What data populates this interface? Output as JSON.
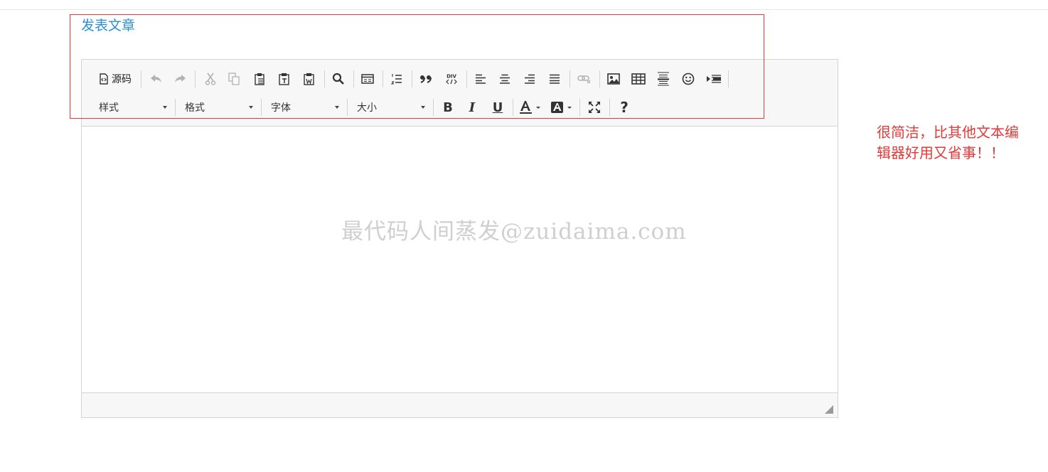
{
  "page": {
    "title": "发表文章",
    "side_note_line1": "很简洁，比其他文本编",
    "side_note_line2": "辑器好用又省事！！"
  },
  "toolbar": {
    "source_label": "源码",
    "combos": [
      {
        "name": "style",
        "label": "样式"
      },
      {
        "name": "format",
        "label": "格式"
      },
      {
        "name": "font",
        "label": "字体"
      },
      {
        "name": "size",
        "label": "大小"
      }
    ],
    "bold_glyph": "B",
    "italic_glyph": "I",
    "underline_glyph": "U",
    "help_glyph": "?"
  },
  "editor": {
    "watermark": "最代码人间蒸发@zuidaima.com"
  },
  "colors": {
    "title": "#2a8fd6",
    "highlight_border": "#e23b3b",
    "side_note": "#e33a3a",
    "toolbar_bg": "#f7f7f7"
  }
}
